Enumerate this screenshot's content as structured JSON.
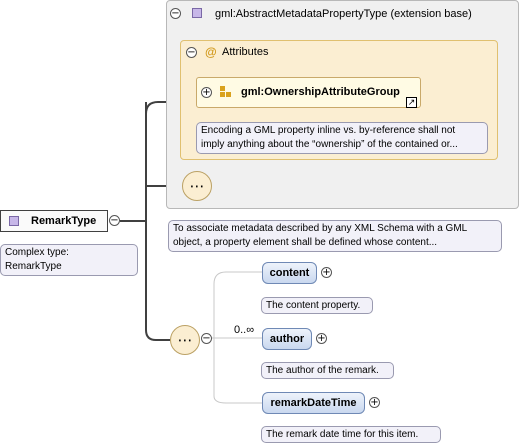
{
  "root": {
    "name": "RemarkType",
    "description": "Complex type:\nRemarkType"
  },
  "extension": {
    "title": "gml:AbstractMetadataPropertyType (extension base)",
    "attributes_label": "Attributes",
    "attribute_group": "gml:OwnershipAttributeGroup",
    "attribute_group_description": "Encoding a GML property inline vs. by-reference shall not\nimply anything about the “ownership” of the contained or...",
    "description": "To associate metadata described by any XML Schema with a GML\nobject, a property element shall be defined whose content..."
  },
  "sequence": {
    "cardinality": "0..∞",
    "elements": [
      {
        "name": "content",
        "description": "The content property."
      },
      {
        "name": "author",
        "description": "The author of the remark."
      },
      {
        "name": "remarkDateTime",
        "description": "The remark date time for this item."
      }
    ]
  },
  "icons": {
    "collapse": "minus-circle-icon",
    "expand": "plus-circle-icon",
    "compositor": "sequence-icon",
    "attribute": "at-icon",
    "link": "link-arrow-icon"
  },
  "colors": {
    "attributes_bg": "#fbeed2",
    "element_bg": "#c9d8ef",
    "extension_bg": "#f0f0f0"
  }
}
